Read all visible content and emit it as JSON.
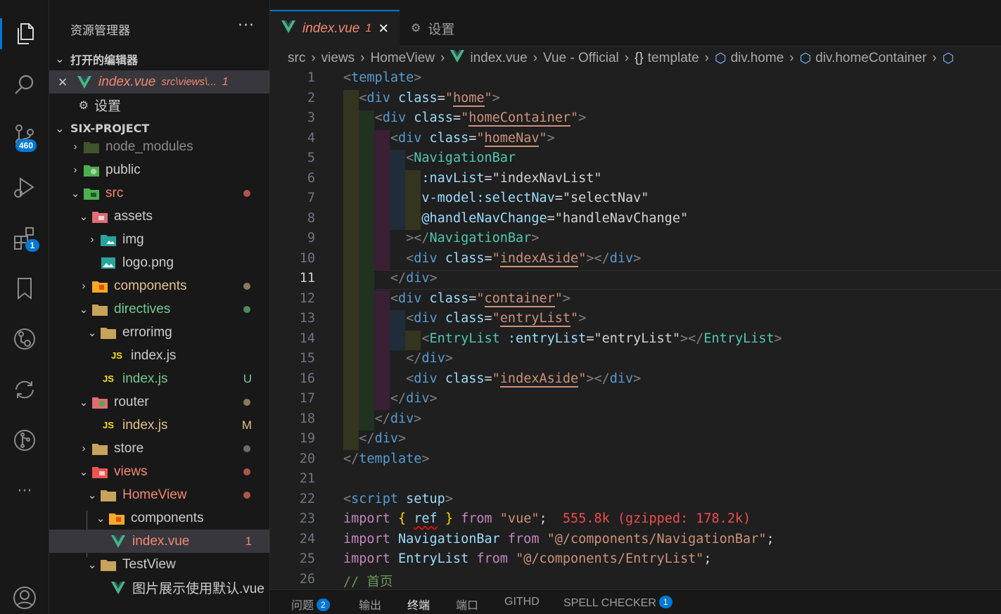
{
  "activity_bar": {
    "scm_badge": "460",
    "extensions_badge": "1",
    "more": "···"
  },
  "sidebar": {
    "title": "资源管理器",
    "more": "···",
    "open_editors": {
      "label": "打开的编辑器",
      "items": [
        {
          "close": "×",
          "name": "index.vue",
          "path": "src\\views\\...",
          "problems": "1"
        },
        {
          "name": "设置"
        }
      ]
    },
    "project": {
      "label": "SIX-PROJECT",
      "tree": [
        {
          "name": "node_modules",
          "color": "#8b8b8b"
        },
        {
          "name": "public",
          "color": "#cccccc"
        },
        {
          "name": "src",
          "color": "#f48771"
        },
        {
          "name": "assets",
          "color": "#cccccc"
        },
        {
          "name": "img",
          "color": "#cccccc"
        },
        {
          "name": "logo.png",
          "color": "#cccccc"
        },
        {
          "name": "components",
          "color": "#e2c08d"
        },
        {
          "name": "directives",
          "color": "#73c991"
        },
        {
          "name": "errorimg",
          "color": "#cccccc"
        },
        {
          "name": "index.js",
          "color": "#cccccc"
        },
        {
          "name": "index.js",
          "color": "#73c991",
          "decoration": "U"
        },
        {
          "name": "router",
          "color": "#cccccc"
        },
        {
          "name": "index.js",
          "color": "#e2c08d",
          "decoration": "M"
        },
        {
          "name": "store",
          "color": "#cccccc"
        },
        {
          "name": "views",
          "color": "#f48771"
        },
        {
          "name": "HomeView",
          "color": "#f48771"
        },
        {
          "name": "components",
          "color": "#cccccc"
        },
        {
          "name": "index.vue",
          "color": "#f48771",
          "decoration": "1"
        },
        {
          "name": "TestView",
          "color": "#cccccc"
        },
        {
          "name": "图片展示使用默认.vue",
          "color": "#cccccc"
        }
      ]
    }
  },
  "tabs": [
    {
      "name": "index.vue",
      "problems": "1",
      "close": "×"
    },
    {
      "name": "设置"
    }
  ],
  "breadcrumb": [
    "src",
    "views",
    "HomeView",
    "index.vue",
    "Vue - Official",
    "template",
    "div.home",
    "div.homeContainer"
  ],
  "editor": {
    "current_line": "11",
    "lines": [
      "1",
      "2",
      "3",
      "4",
      "5",
      "6",
      "7",
      "8",
      "9",
      "10",
      "11",
      "12",
      "13",
      "14",
      "15",
      "16",
      "17",
      "18",
      "19",
      "20",
      "21",
      "22",
      "23",
      "24",
      "25",
      "26"
    ],
    "import_cost": "555.8k (gzipped: 178.2k)",
    "comment": "// 首页"
  },
  "panel": {
    "tabs": [
      {
        "label": "问题",
        "badge": "2"
      },
      {
        "label": "输出"
      },
      {
        "label": "终端"
      },
      {
        "label": "端口"
      },
      {
        "label": "GITHD"
      },
      {
        "label": "SPELL CHECKER",
        "badge": "1"
      }
    ]
  },
  "colors": {
    "accent": "#0078d4",
    "vue_green": "#41b883",
    "error_red": "#f48771",
    "modified": "#e2c08d",
    "untracked": "#73c991"
  }
}
